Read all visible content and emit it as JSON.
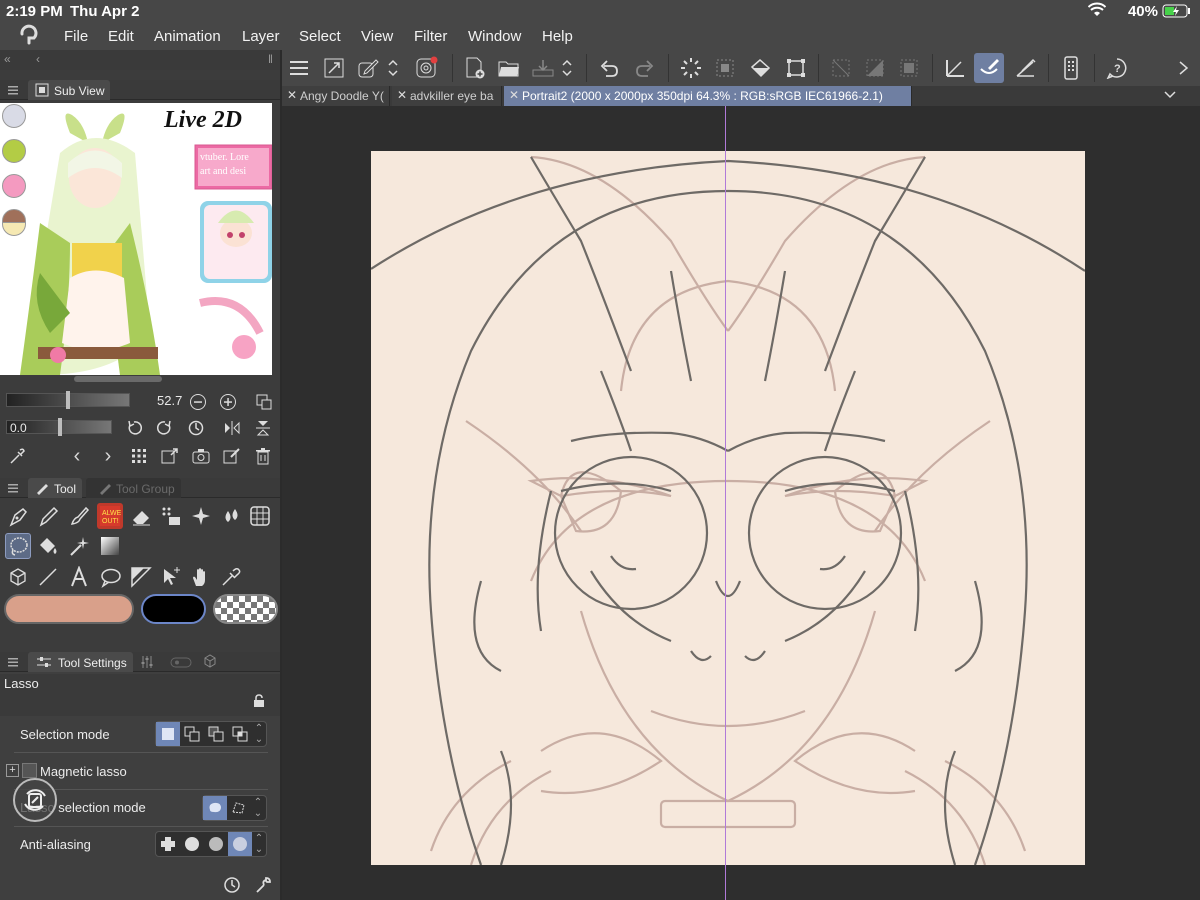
{
  "status": {
    "time": "2:19 PM",
    "date": "Thu Apr 2",
    "battery": "40%"
  },
  "menu": [
    "File",
    "Edit",
    "Animation",
    "Layer",
    "Select",
    "View",
    "Filter",
    "Window",
    "Help"
  ],
  "subview": {
    "tab": "Sub View",
    "ref_title": "Live 2D",
    "ref_banner_1": "vtuber. Lore",
    "ref_banner_2": "art and desi",
    "swatches": [
      "#d9dbe6",
      "#b3cc45",
      "#f49ac0",
      "#a0705a",
      "#f6e9b3"
    ],
    "zoom": "52.7",
    "rotation": "0.0"
  },
  "palette": {
    "tab_tool": "Tool",
    "tab_group": "Tool Group",
    "main_color": "#d9a08a",
    "sub_color": "#000000"
  },
  "tool_settings": {
    "tab": "Tool Settings",
    "tool_name": "Lasso",
    "rows": {
      "selection_mode": "Selection mode",
      "magnetic_lasso": "Magnetic lasso",
      "lasso_selection_mode": "Lasso selection mode",
      "anti_aliasing": "Anti-aliasing"
    }
  },
  "tabs": [
    {
      "label": "Angy Doodle Y("
    },
    {
      "label": "advkiller eye ba"
    },
    {
      "label": "Portrait2 (2000 x 2000px 350dpi 64.3% : RGB:sRGB IEC61966-2.1)"
    }
  ],
  "canvas": {
    "bg": "#f6e8dc",
    "line_dark": "#6e6a66",
    "line_light": "#c9aea4",
    "guide": "#b07ad8"
  }
}
